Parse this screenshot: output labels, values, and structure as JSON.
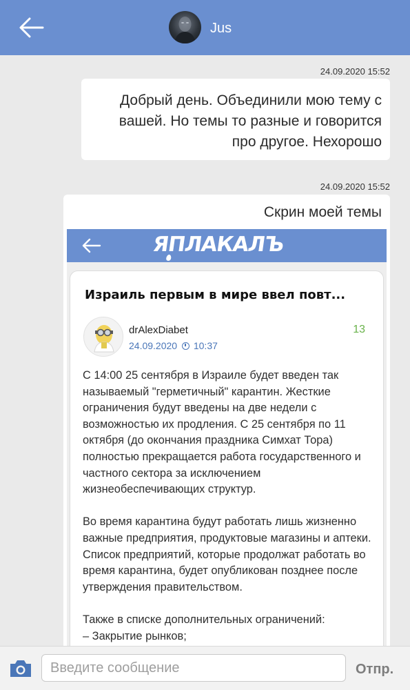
{
  "header": {
    "contact_name": "Jus",
    "back_icon": "arrow-left-icon",
    "color": "#6a8fd0"
  },
  "messages": [
    {
      "timestamp": "24.09.2020 15:52",
      "text": "Добрый день. Объединили мою тему с вашей. Но темы то разные и говорится про другое. Нехорошо"
    },
    {
      "timestamp": "24.09.2020 15:52",
      "caption": "Скрин моей темы",
      "screenshot": {
        "logo": "ЯПЛАКАЛЪ",
        "post_title": "Израиль первым в мире ввел повт...",
        "author": "drAlexDiabet",
        "date": "24.09.2020",
        "time": "10:37",
        "comments": "13",
        "paragraphs": [
          "С 14:00 25 сентября в Израиле будет введен так называемый \"герметичный\" карантин. Жесткие ограничения будут введены на две недели с возможностью их продления. С 25 сентября по 11 октября (до окончания праздника Симхат Тора) полностью прекращается работа государственного и частного сектора за исключением жизнеобеспечивающих структур.",
          "Во время карантина будут работать лишь жизненно важные предприятия, продуктовые магазины и аптеки. Список предприятий, которые продолжат работать во время карантина, будет опубликован позднее после утверждения правительством.",
          "Также в списке дополнительных ограничений:",
          "– Закрытие рынков;"
        ]
      }
    }
  ],
  "composer": {
    "placeholder": "Введите сообщение",
    "value": "",
    "send_label": "Отпр.",
    "camera_icon": "camera-icon",
    "accent": "#4a76b8"
  }
}
